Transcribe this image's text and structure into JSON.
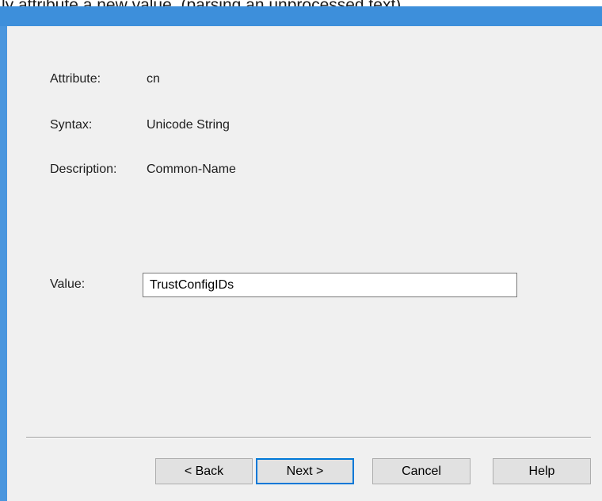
{
  "page_caption": "ly attribute a new value. (parsing an unprocessed text)",
  "dialog": {
    "title": "",
    "accent_color": "#3d8fdb",
    "background_color": "#f0f0f0"
  },
  "attribute": {
    "label": "Attribute:",
    "value": "cn"
  },
  "syntax": {
    "label": "Syntax:",
    "value": "Unicode String"
  },
  "description": {
    "label": "Description:",
    "value": "Common-Name"
  },
  "value_field": {
    "label": "Value:",
    "value": "TrustConfigIDs"
  },
  "buttons": {
    "back": "< Back",
    "next": "Next >",
    "cancel": "Cancel",
    "help": "Help"
  }
}
